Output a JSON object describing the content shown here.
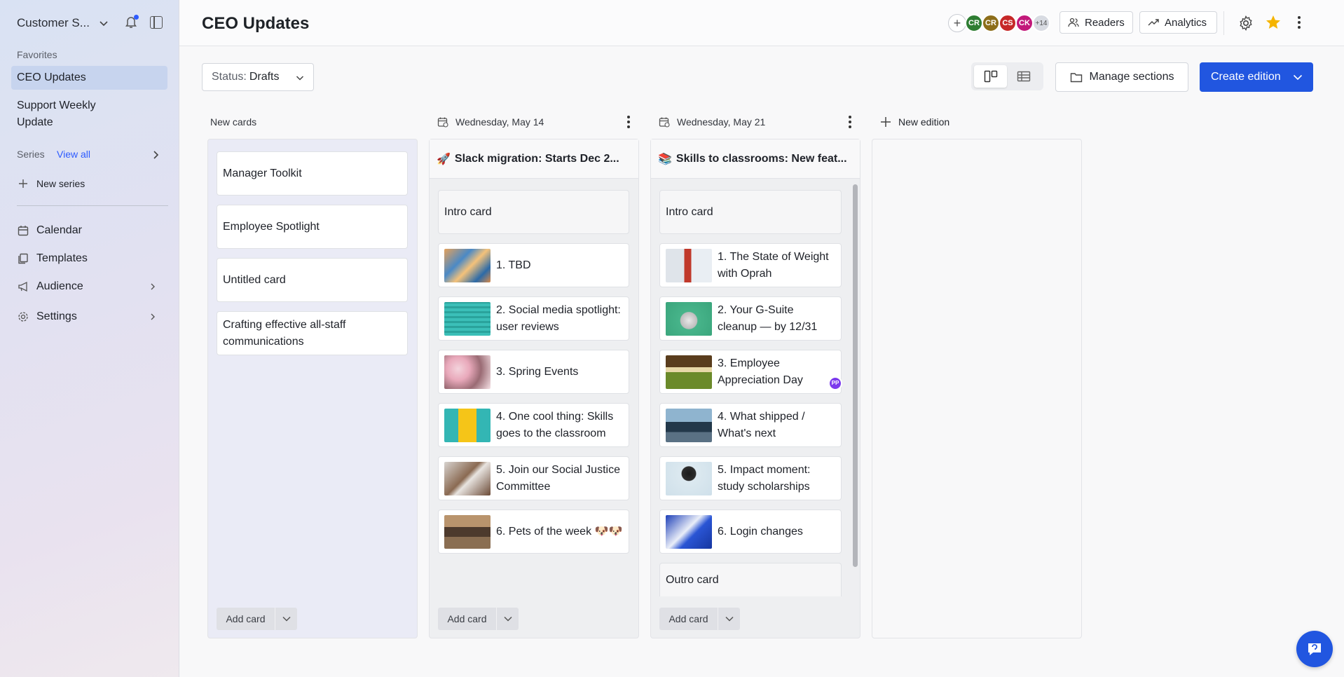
{
  "sidebar": {
    "workspace_name": "Customer S...",
    "favorites_label": "Favorites",
    "favorites": [
      {
        "label": "CEO Updates",
        "active": true
      },
      {
        "label": "Support Weekly Update",
        "active": false
      }
    ],
    "series_label": "Series",
    "view_all": "View all",
    "new_series": "New series",
    "nav": [
      {
        "label": "Calendar",
        "icon": "calendar-icon",
        "has_arrow": false
      },
      {
        "label": "Templates",
        "icon": "templates-icon",
        "has_arrow": false
      },
      {
        "label": "Audience",
        "icon": "megaphone-icon",
        "has_arrow": true
      },
      {
        "label": "Settings",
        "icon": "gear-icon",
        "has_arrow": true
      }
    ]
  },
  "header": {
    "title": "CEO Updates",
    "avatars": [
      {
        "initials": "CR",
        "color": "#2e7d32"
      },
      {
        "initials": "CR",
        "color": "#8d6e1a"
      },
      {
        "initials": "CS",
        "color": "#c62828"
      },
      {
        "initials": "CK",
        "color": "#c2187a"
      }
    ],
    "avatars_more": "+14",
    "readers_label": "Readers",
    "analytics_label": "Analytics",
    "star_color": "#f5b400"
  },
  "toolbar": {
    "status_label": "Status:",
    "status_value": "Drafts",
    "manage_sections_label": "Manage sections",
    "create_edition_label": "Create edition",
    "accent": "#2156e0"
  },
  "columns": [
    {
      "type": "new-cards",
      "header": "New cards",
      "cards": [
        "Manager Toolkit",
        "Employee Spotlight",
        "Untitled card",
        "Crafting effective all-staff communications"
      ],
      "add_card": "Add card"
    },
    {
      "type": "edition",
      "date": "Wednesday, May 14",
      "emoji": "🚀",
      "title": "Slack migration: Starts Dec 2...",
      "intro": "Intro card",
      "cards": [
        "1. TBD",
        "2. Social media spotlight: user reviews",
        "3. Spring Events",
        "4. One cool thing: Skills goes to the classroom",
        "5. Join our Social Justice Committee",
        "6. Pets of the week 🐶🐶"
      ],
      "add_card": "Add card"
    },
    {
      "type": "edition",
      "date": "Wednesday, May 21",
      "emoji": "📚",
      "title": "Skills to classrooms: New feat...",
      "intro": "Intro card",
      "cards": [
        "1. The State of Weight with Oprah",
        "2. Your G-Suite cleanup — by 12/31",
        "3. Employee Appreciation Day",
        "4. What shipped / What's next",
        "5. Impact moment: study scholarships",
        "6. Login changes"
      ],
      "outro": "Outro card",
      "badge": "PP",
      "add_card": "Add card"
    }
  ],
  "new_edition_label": "New edition"
}
